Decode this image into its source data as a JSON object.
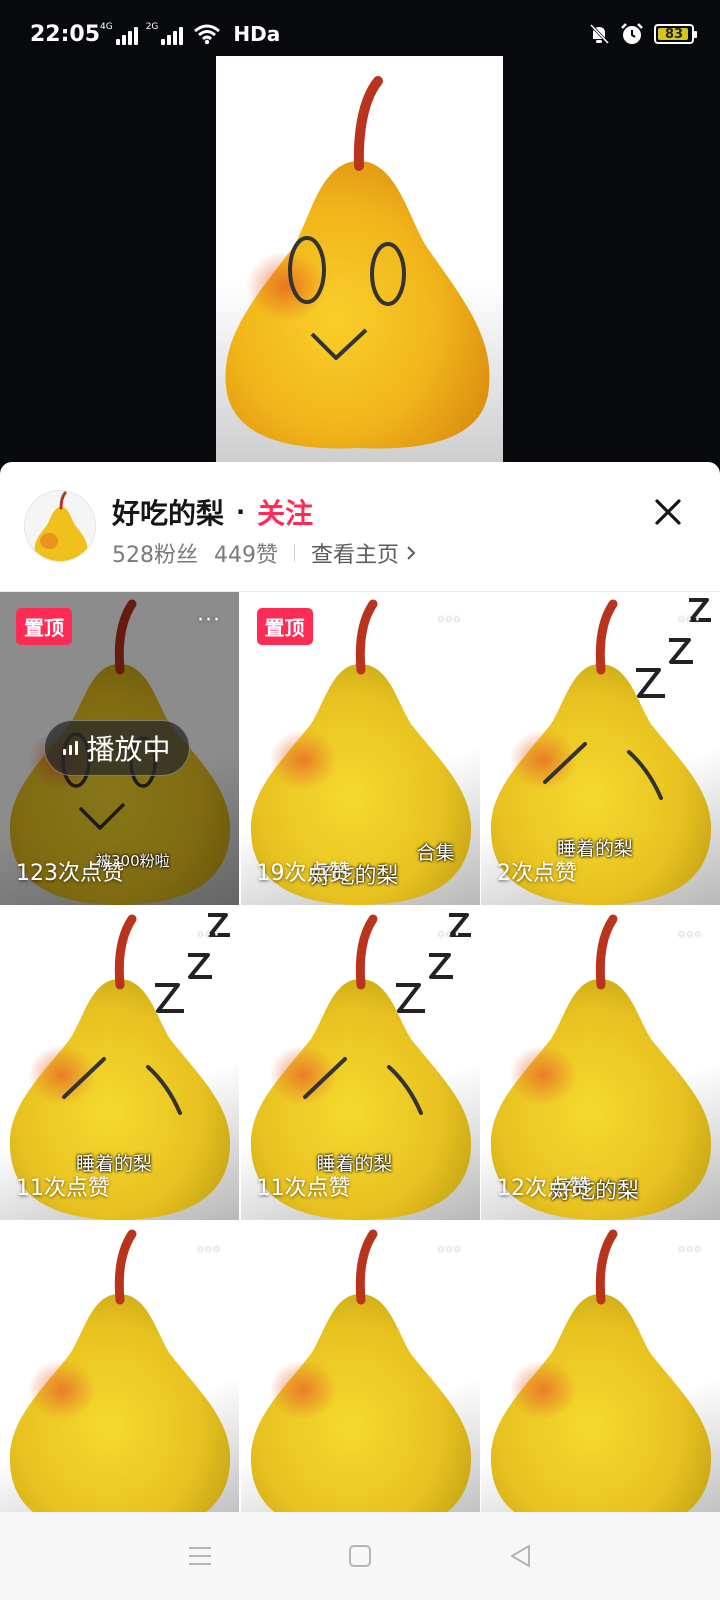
{
  "status_bar": {
    "time": "22:05",
    "signal1_label": "4G",
    "signal2_label": "2G",
    "hd_label": "HDa",
    "battery": "83",
    "icons": [
      "signal-icon",
      "wifi-icon",
      "mute-icon",
      "alarm-icon",
      "battery-icon"
    ]
  },
  "profile": {
    "name": "好吃的梨",
    "separator": "·",
    "follow_label": "关注",
    "followers": "528粉丝",
    "likes": "449赞",
    "homepage_label": "查看主页"
  },
  "grid": {
    "playing_label": "播放中",
    "pinned_label": "置顶",
    "more_label": "···",
    "tiles": [
      {
        "likes": "123次点赞",
        "pinned": true,
        "playing": true,
        "caption": "被300粉啦"
      },
      {
        "likes": "19次点赞",
        "pinned": true,
        "caption": "好吃的梨",
        "caption2": "合集"
      },
      {
        "likes": "2次点赞",
        "caption": "睡着的梨"
      },
      {
        "likes": "11次点赞",
        "caption": "睡着的梨"
      },
      {
        "likes": "11次点赞",
        "caption": "睡着的梨"
      },
      {
        "likes": "12次点赞",
        "caption": "好吃的梨"
      },
      {
        "likes": ""
      },
      {
        "likes": ""
      },
      {
        "likes": ""
      }
    ]
  },
  "colors": {
    "accent": "#fe2c55",
    "pear_yellow": "#f2c21b",
    "pear_orange": "#e9752a",
    "stem": "#b8341c"
  }
}
